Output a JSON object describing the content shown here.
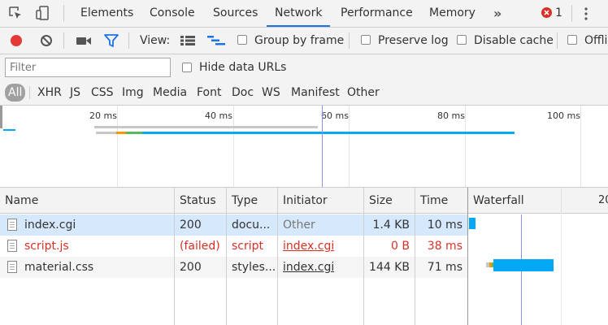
{
  "tabs": [
    {
      "label": "Elements",
      "active": false
    },
    {
      "label": "Console",
      "active": false
    },
    {
      "label": "Sources",
      "active": false
    },
    {
      "label": "Network",
      "active": true
    },
    {
      "label": "Performance",
      "active": false
    },
    {
      "label": "Memory",
      "active": false
    }
  ],
  "tabs_overflow": "»",
  "error_count": "1",
  "toolbar": {
    "view_label": "View:",
    "group_by_frame": "Group by frame",
    "preserve_log": "Preserve log",
    "disable_cache": "Disable cache",
    "offline": "Offli"
  },
  "filter": {
    "placeholder": "Filter",
    "hide_data_urls": "Hide data URLs"
  },
  "type_filters": [
    "All",
    "XHR",
    "JS",
    "CSS",
    "Img",
    "Media",
    "Font",
    "Doc",
    "WS",
    "Manifest",
    "Other"
  ],
  "overview": {
    "ticks": [
      "20 ms",
      "40 ms",
      "60 ms",
      "80 ms",
      "100 ms"
    ]
  },
  "table": {
    "columns": [
      "Name",
      "Status",
      "Type",
      "Initiator",
      "Size",
      "Time",
      "Waterfall"
    ],
    "waterfall_tick_partial": "20",
    "rows": [
      {
        "name": "index.cgi",
        "status": "200",
        "type": "docu...",
        "initiator": "Other",
        "size": "1.4 KB",
        "time": "10 ms",
        "failed": false
      },
      {
        "name": "script.js",
        "status": "(failed)",
        "type": "script",
        "initiator": "index.cgi",
        "size": "0 B",
        "time": "38 ms",
        "failed": true
      },
      {
        "name": "material.css",
        "status": "200",
        "type": "styles...",
        "initiator": "index.cgi",
        "size": "144 KB",
        "time": "71 ms",
        "failed": false
      }
    ]
  },
  "colors": {
    "record": "#e53935",
    "filter_active": "#1a73e8",
    "error_badge": "#d93025",
    "waterfall_bar": "#03a9f4",
    "selected_row": "#d6e8fb",
    "failed_text": "#d93025"
  }
}
